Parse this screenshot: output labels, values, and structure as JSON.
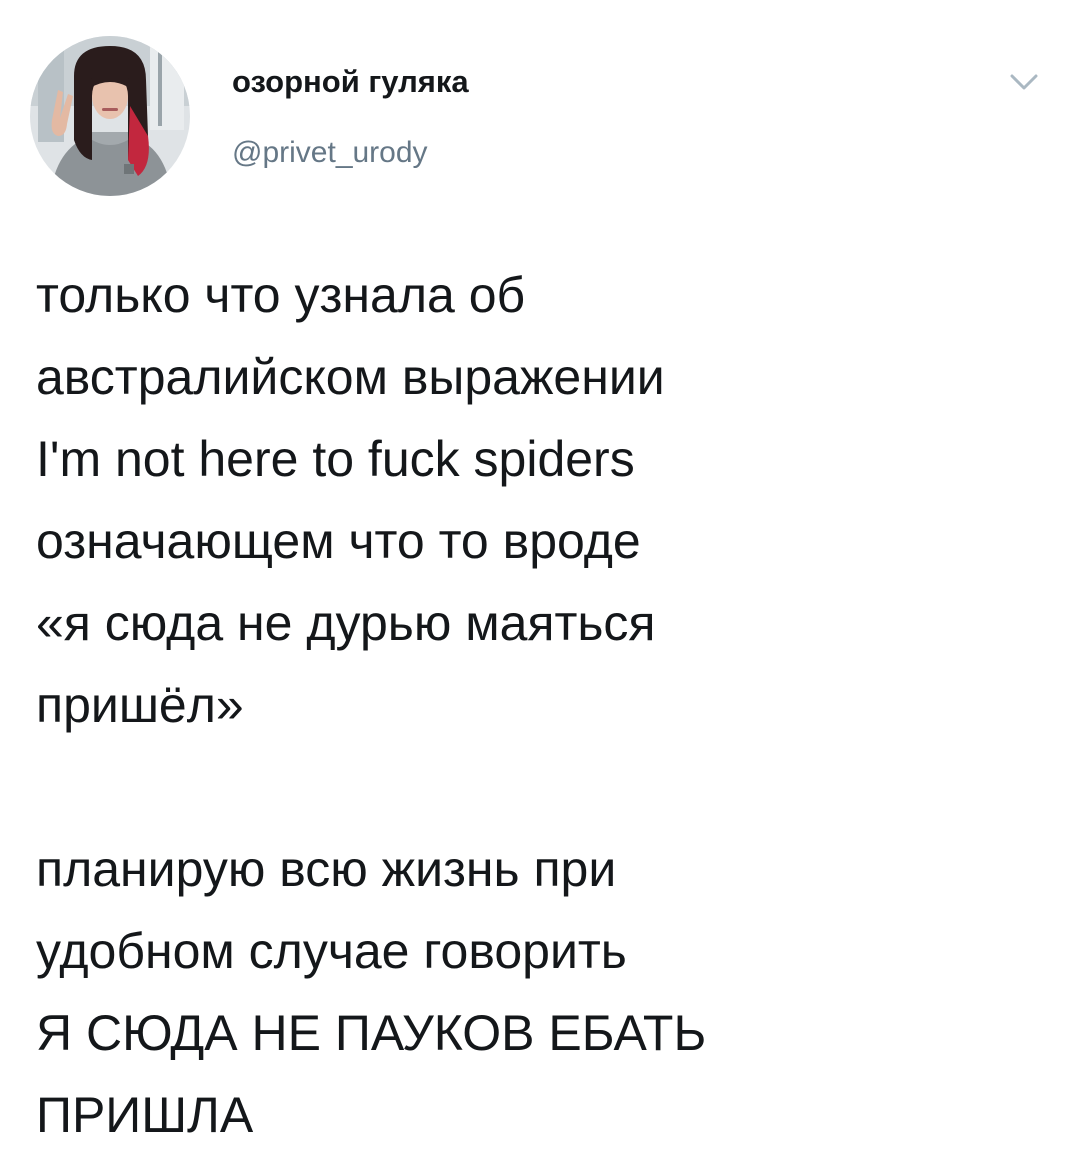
{
  "tweet": {
    "author": {
      "display_name": "озорной гуляка",
      "handle": "@privet_urody"
    },
    "paragraphs": [
      [
        "только что узнала об",
        "австралийском выражении",
        "I'm not here to fuck spiders",
        "означающем что то вроде",
        "«я сюда не дурью маяться",
        "пришёл»"
      ],
      [
        "планирую всю жизнь при",
        "удобном случае говорить",
        "Я СЮДА НЕ ПАУКОВ ЕБАТЬ",
        "ПРИШЛА"
      ]
    ]
  },
  "icons": {
    "menu": "chevron-down-icon",
    "avatar": "profile-photo"
  },
  "colors": {
    "text": "#14171a",
    "secondary_text": "#657786",
    "caret": "#aab8c2",
    "background": "#ffffff"
  }
}
